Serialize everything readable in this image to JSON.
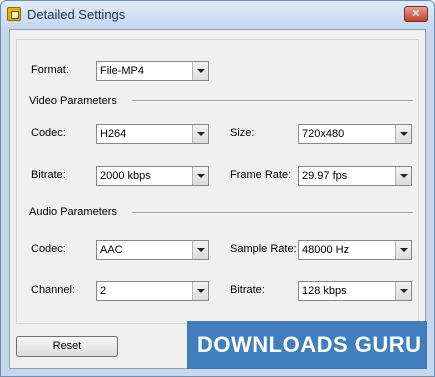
{
  "window": {
    "title": "Detailed Settings",
    "close_glyph": "✕"
  },
  "format": {
    "label": "Format:",
    "value": "File-MP4"
  },
  "video": {
    "section_title": "Video Parameters",
    "codec": {
      "label": "Codec:",
      "value": "H264"
    },
    "size": {
      "label": "Size:",
      "value": "720x480"
    },
    "bitrate": {
      "label": "Bitrate:",
      "value": "2000 kbps"
    },
    "frame_rate": {
      "label": "Frame Rate:",
      "value": "29.97 fps"
    }
  },
  "audio": {
    "section_title": "Audio Parameters",
    "codec": {
      "label": "Codec:",
      "value": "AAC"
    },
    "sample_rate": {
      "label": "Sample Rate:",
      "value": "48000 Hz"
    },
    "channel": {
      "label": "Channel:",
      "value": "2"
    },
    "bitrate": {
      "label": "Bitrate:",
      "value": "128 kbps"
    }
  },
  "buttons": {
    "reset": "Reset"
  },
  "watermark": {
    "text": "DOWNLOADS GURU"
  },
  "colors": {
    "watermark_bg": "#2a6fb8",
    "titlebar": "#c3d6ec",
    "close_button": "#c4412b"
  }
}
